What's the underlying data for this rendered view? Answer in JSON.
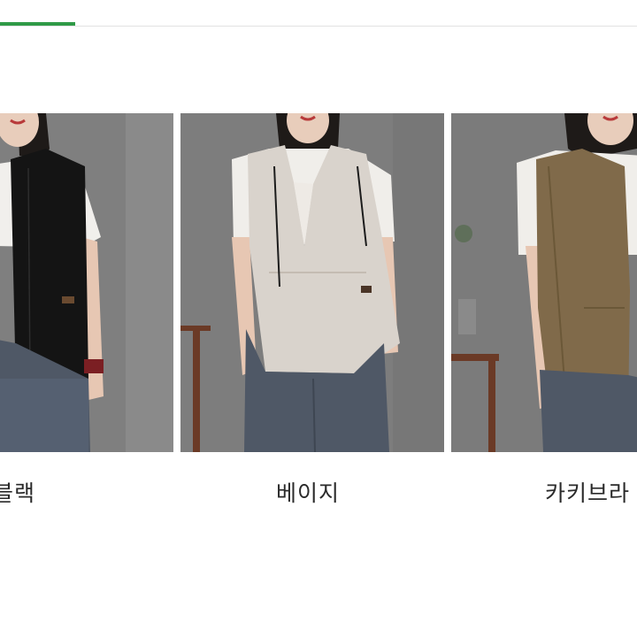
{
  "colors": {
    "tab_indicator": "#2f9a47",
    "rule": "#e2e2e2",
    "backdrop": "#7d7d7d",
    "jeans": "#4f5866"
  },
  "products": [
    {
      "label": "블랙",
      "vest_color": "#141414"
    },
    {
      "label": "베이지",
      "vest_color": "#d9d3cc"
    },
    {
      "label": "카키브라",
      "vest_color": "#806a4a"
    }
  ]
}
